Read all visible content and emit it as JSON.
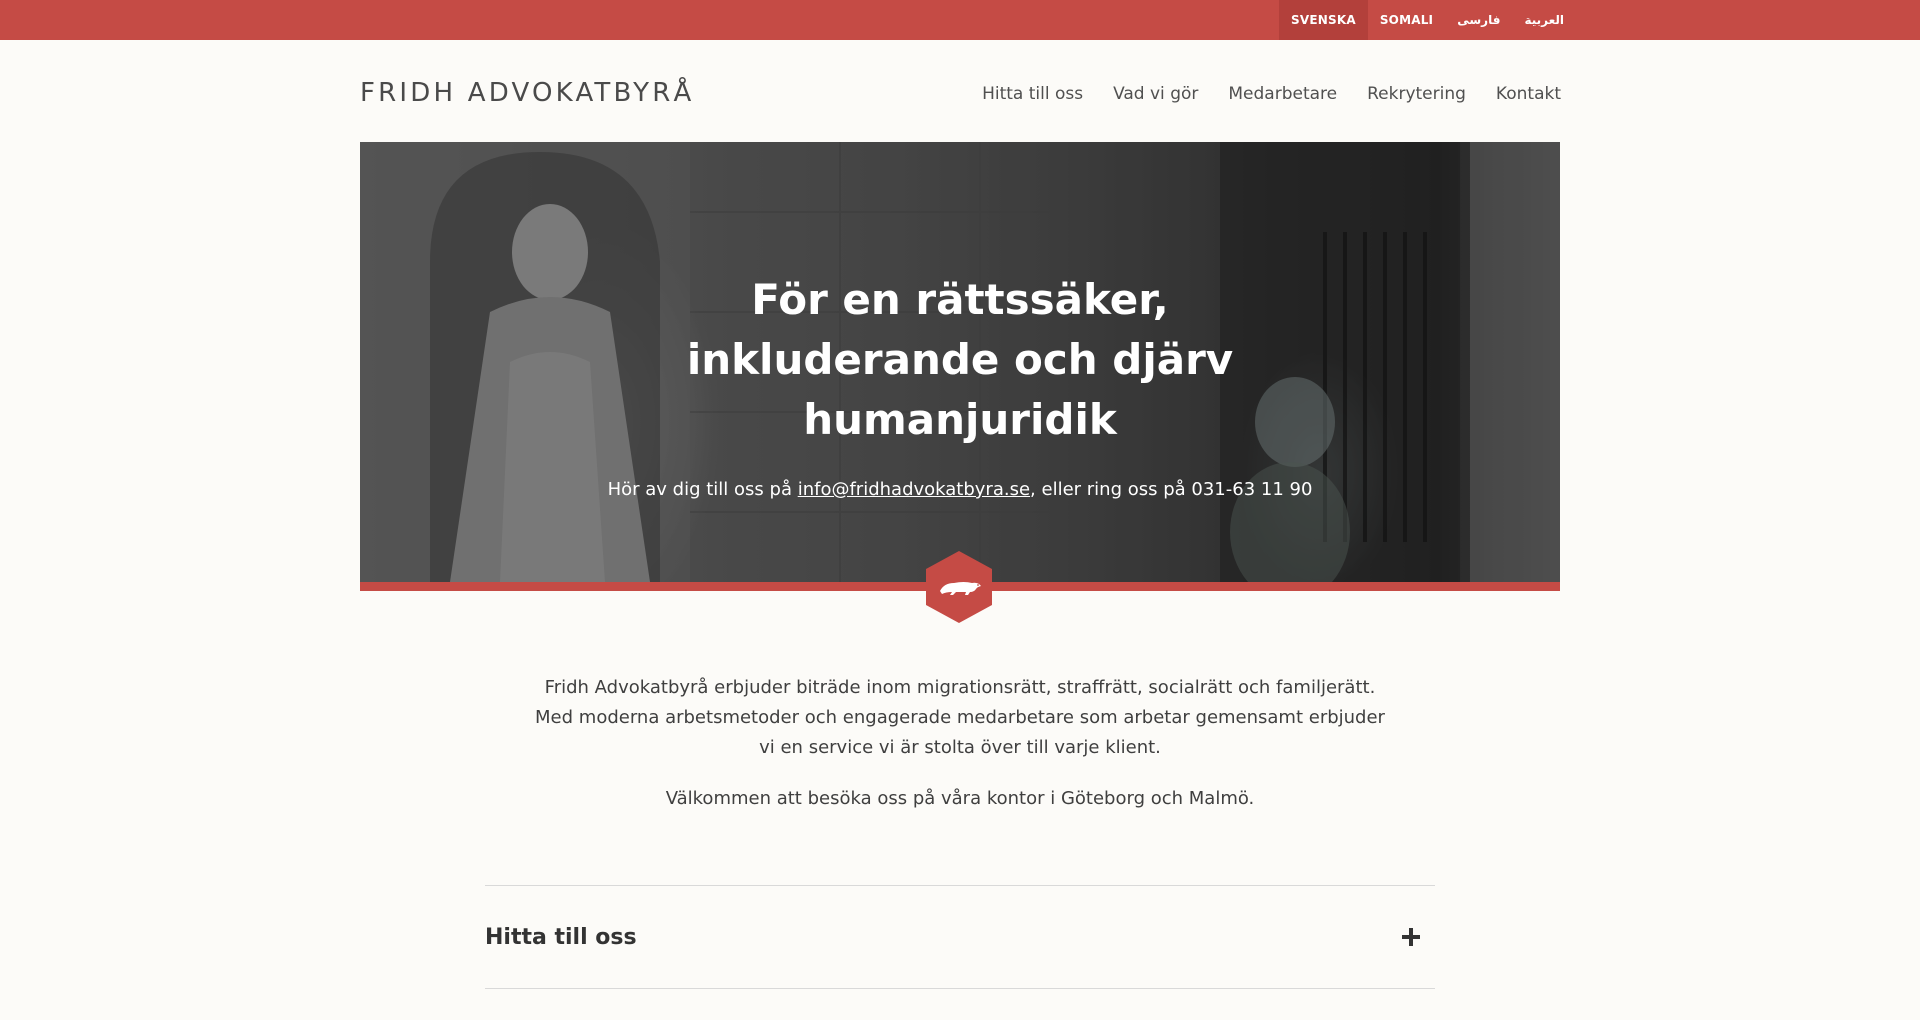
{
  "languages": [
    {
      "label": "SVENSKA",
      "active": true
    },
    {
      "label": "SOMALI",
      "active": false
    },
    {
      "label": "فارسی",
      "active": false
    },
    {
      "label": "العربية",
      "active": false
    }
  ],
  "header": {
    "logo": "FRIDH ADVOKATBYRÅ",
    "nav": [
      "Hitta till oss",
      "Vad vi gör",
      "Medarbetare",
      "Rekrytering",
      "Kontakt"
    ]
  },
  "hero": {
    "title": "För en rättssäker, inkluderande och djärv humanjuridik",
    "contact_prefix": "Hör av dig till oss på ",
    "email": "info@fridhadvokatbyra.se",
    "contact_suffix": ", eller ring oss på 031-63 11 90",
    "emblem_icon": "weasel-hexagon-icon"
  },
  "intro": {
    "paragraph1": "Fridh Advokatbyrå erbjuder biträde inom migrationsrätt, straffrätt, socialrätt och familjerätt.  Med moderna arbetsmetoder och engagerade medarbetare som arbetar gemensamt erbjuder vi en service vi är stolta över till varje klient.",
    "paragraph2": "Välkommen att besöka oss på våra kontor i Göteborg och Malmö."
  },
  "accordion": {
    "items": [
      {
        "title": "Hitta till oss",
        "icon": "plus-icon"
      }
    ]
  },
  "colors": {
    "accent": "#c54b45",
    "background": "#fcfbf8",
    "text": "#3d3d3d"
  }
}
